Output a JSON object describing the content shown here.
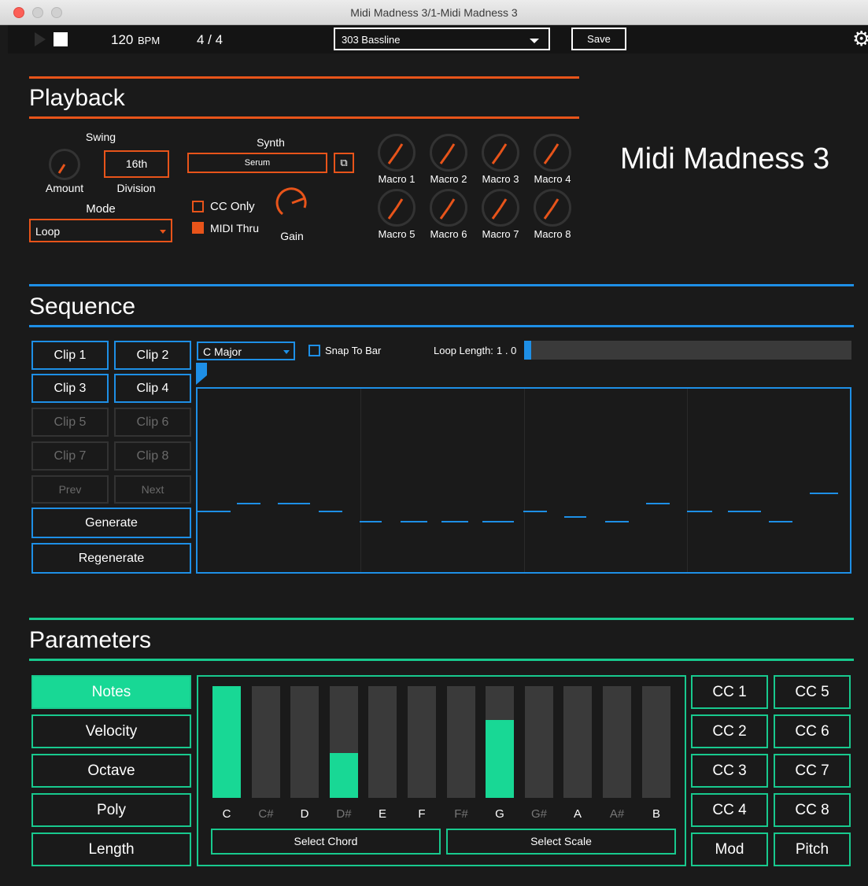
{
  "window": {
    "title": "Midi Madness 3/1-Midi Madness 3"
  },
  "toolbar": {
    "tempo": "120",
    "tempo_unit": "BPM",
    "time_signature": "4 / 4",
    "preset": "303 Bassline",
    "save_label": "Save"
  },
  "playback": {
    "title": "Playback",
    "swing_label": "Swing",
    "swing_value": "16th",
    "amount_label": "Amount",
    "division_label": "Division",
    "mode_label": "Mode",
    "mode_value": "Loop",
    "synth_label": "Synth",
    "synth_value": "Serum",
    "cc_only_label": "CC Only",
    "cc_only_checked": false,
    "midi_thru_label": "MIDI Thru",
    "midi_thru_checked": true,
    "gain_label": "Gain",
    "macros": [
      "Macro 1",
      "Macro 2",
      "Macro 3",
      "Macro 4",
      "Macro 5",
      "Macro 6",
      "Macro 7",
      "Macro 8"
    ]
  },
  "device_name": "Midi Madness 3",
  "sequence": {
    "title": "Sequence",
    "clips": [
      "Clip 1",
      "Clip 2",
      "Clip 3",
      "Clip 4",
      "Clip 5",
      "Clip 6",
      "Clip 7",
      "Clip 8"
    ],
    "prev_label": "Prev",
    "next_label": "Next",
    "generate_label": "Generate",
    "regenerate_label": "Regenerate",
    "scale": "C Major",
    "snap_label": "Snap To Bar",
    "snap_checked": false,
    "loop_length_label": "Loop Length:",
    "loop_length_value": "1 . 0"
  },
  "parameters": {
    "title": "Parameters",
    "tabs": [
      "Notes",
      "Velocity",
      "Octave",
      "Poly",
      "Length"
    ],
    "active_tab": "Notes",
    "notes": [
      "C",
      "C#",
      "D",
      "D#",
      "E",
      "F",
      "F#",
      "G",
      "G#",
      "A",
      "A#",
      "B"
    ],
    "note_levels": [
      1.0,
      0,
      0,
      0.4,
      0,
      0,
      0,
      0.7,
      0,
      0,
      0,
      0
    ],
    "select_chord_label": "Select Chord",
    "select_scale_label": "Select Scale",
    "cc_buttons": [
      "CC 1",
      "CC 5",
      "CC 2",
      "CC 6",
      "CC 3",
      "CC 7",
      "CC 4",
      "CC 8",
      "Mod",
      "Pitch"
    ]
  },
  "colors": {
    "playback_accent": "#e8541a",
    "sequence_accent": "#1e8fe6",
    "parameters_accent": "#18c98e"
  }
}
